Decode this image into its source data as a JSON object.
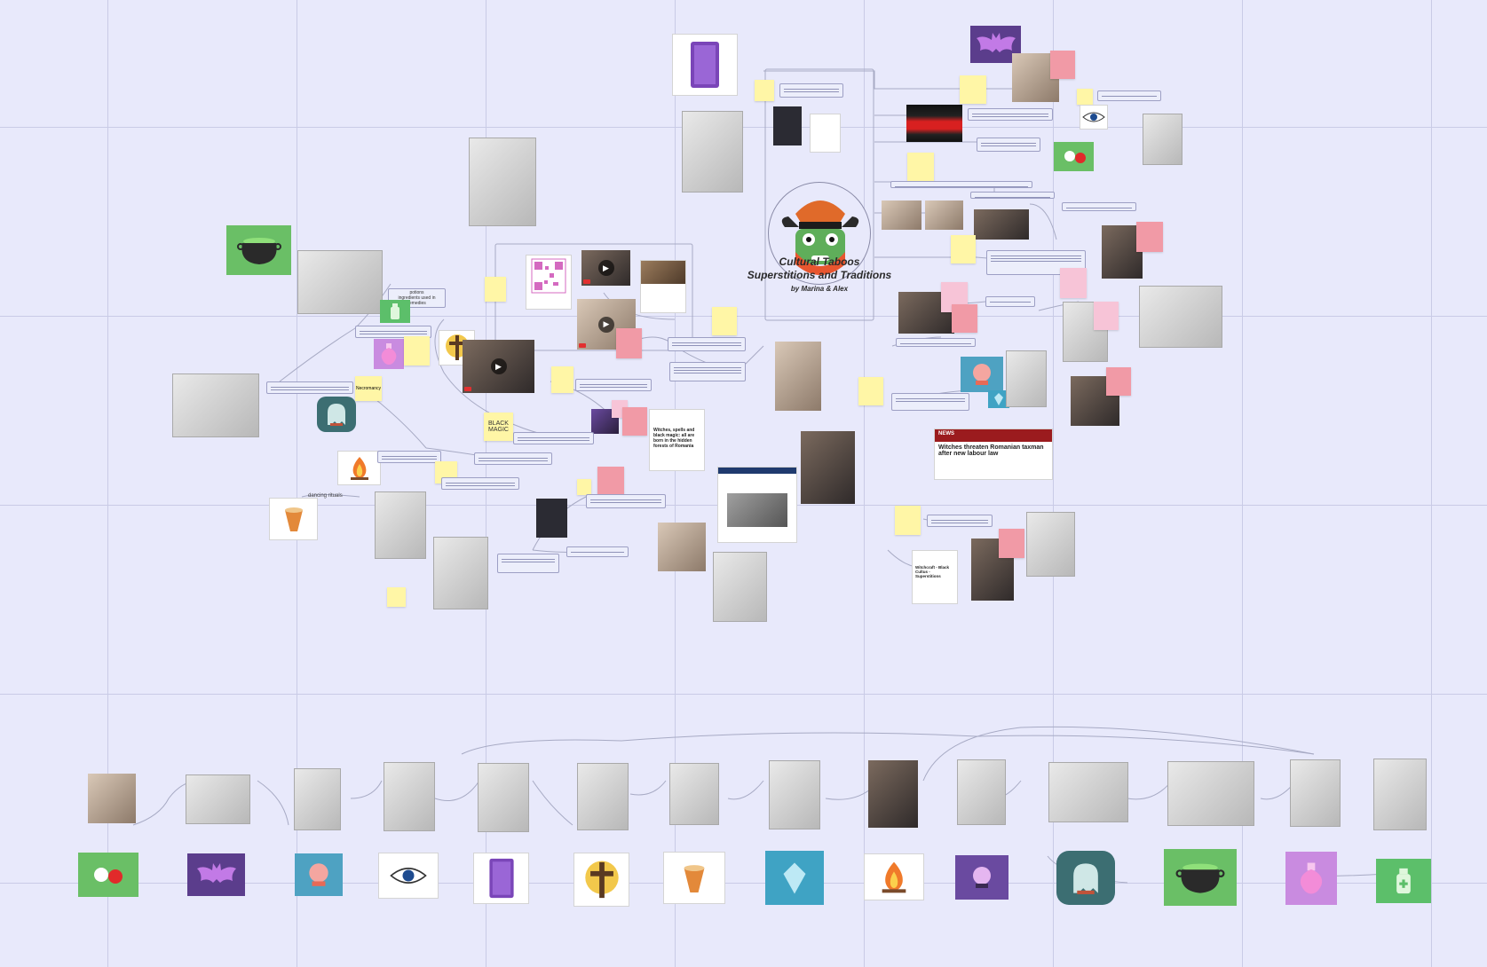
{
  "board": {
    "title_line1": "Cultural Taboos",
    "title_line2": "Superstitions and Traditions",
    "byline": "by Marina & Alex"
  },
  "labels": {
    "black_magic_line1": "BLACK",
    "black_magic_line2": "MAGIC",
    "necromancy": "Necromancy",
    "dancing_rituals": "dancing rituals",
    "potion_line1": "potions",
    "potion_line2": "ingredients used in",
    "potion_line3": "remedies"
  },
  "news": {
    "section": "NEWS",
    "headline": "Witches threaten Romanian taxman after new labour law"
  },
  "article": {
    "headline": "Witches, spells and black magic: all are born in the hidden forests of Romania"
  },
  "doc": {
    "headline": "Witchcraft - Black Cultus - Superstitions"
  },
  "icons": {
    "cauldron": "cauldron-icon",
    "potion": "potion-icon",
    "cross": "cross-icon",
    "ghost": "ghost-icon",
    "fire": "fire-icon",
    "drum": "drum-icon",
    "bat": "bat-icon",
    "eye": "evil-eye-icon",
    "book": "spell-book-icon",
    "crystal": "crystal-icon",
    "orb": "crystal-ball-icon",
    "bottle": "medicine-bottle-icon",
    "doll": "voodoo-doll-icon"
  }
}
